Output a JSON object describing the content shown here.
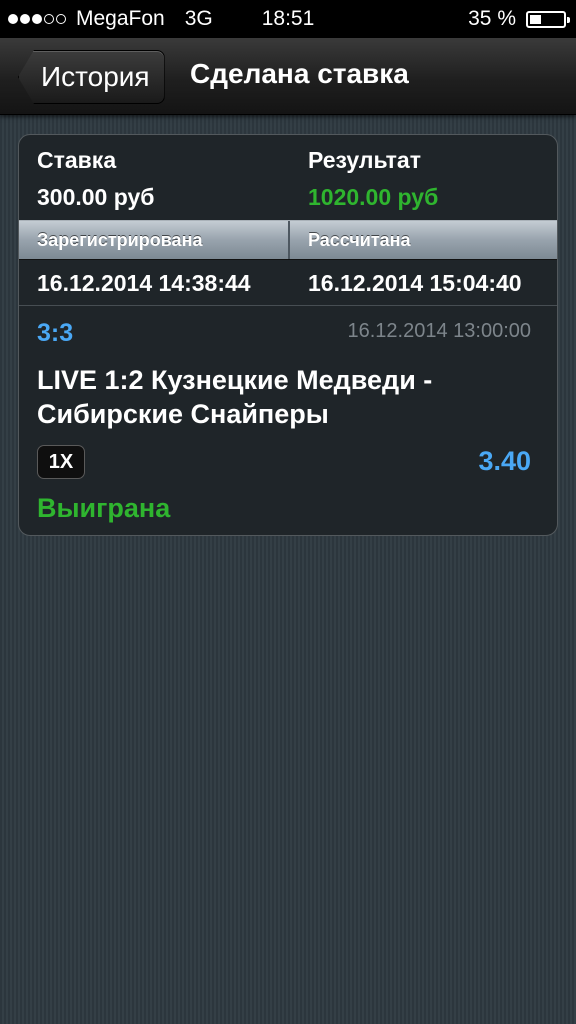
{
  "status_bar": {
    "carrier": "MegaFon",
    "network": "3G",
    "time": "18:51",
    "battery_text": "35 %",
    "battery_level": 0.35,
    "signal_bars_filled": 3,
    "signal_bars_total": 5
  },
  "nav": {
    "back_label": "История",
    "title": "Сделана ставка"
  },
  "bet": {
    "stake_label": "Ставка",
    "stake_value": "300.00 руб",
    "result_label": "Результат",
    "result_value": "1020.00 руб",
    "registered_label": "Зарегистрирована",
    "settled_label": "Рассчитана",
    "registered_value": "16.12.2014 14:38:44",
    "settled_value": "16.12.2014 15:04:40"
  },
  "event": {
    "score": "3:3",
    "date": "16.12.2014 13:00:00",
    "name": "LIVE 1:2 Кузнецкие Медведи - Сибирские Снайперы",
    "bet_type": "1X",
    "odds": "3.40",
    "status": "Выиграна"
  },
  "colors": {
    "accent_blue": "#4aa8f5",
    "win_green": "#2fb52f",
    "muted_gray": "#7d858b"
  }
}
